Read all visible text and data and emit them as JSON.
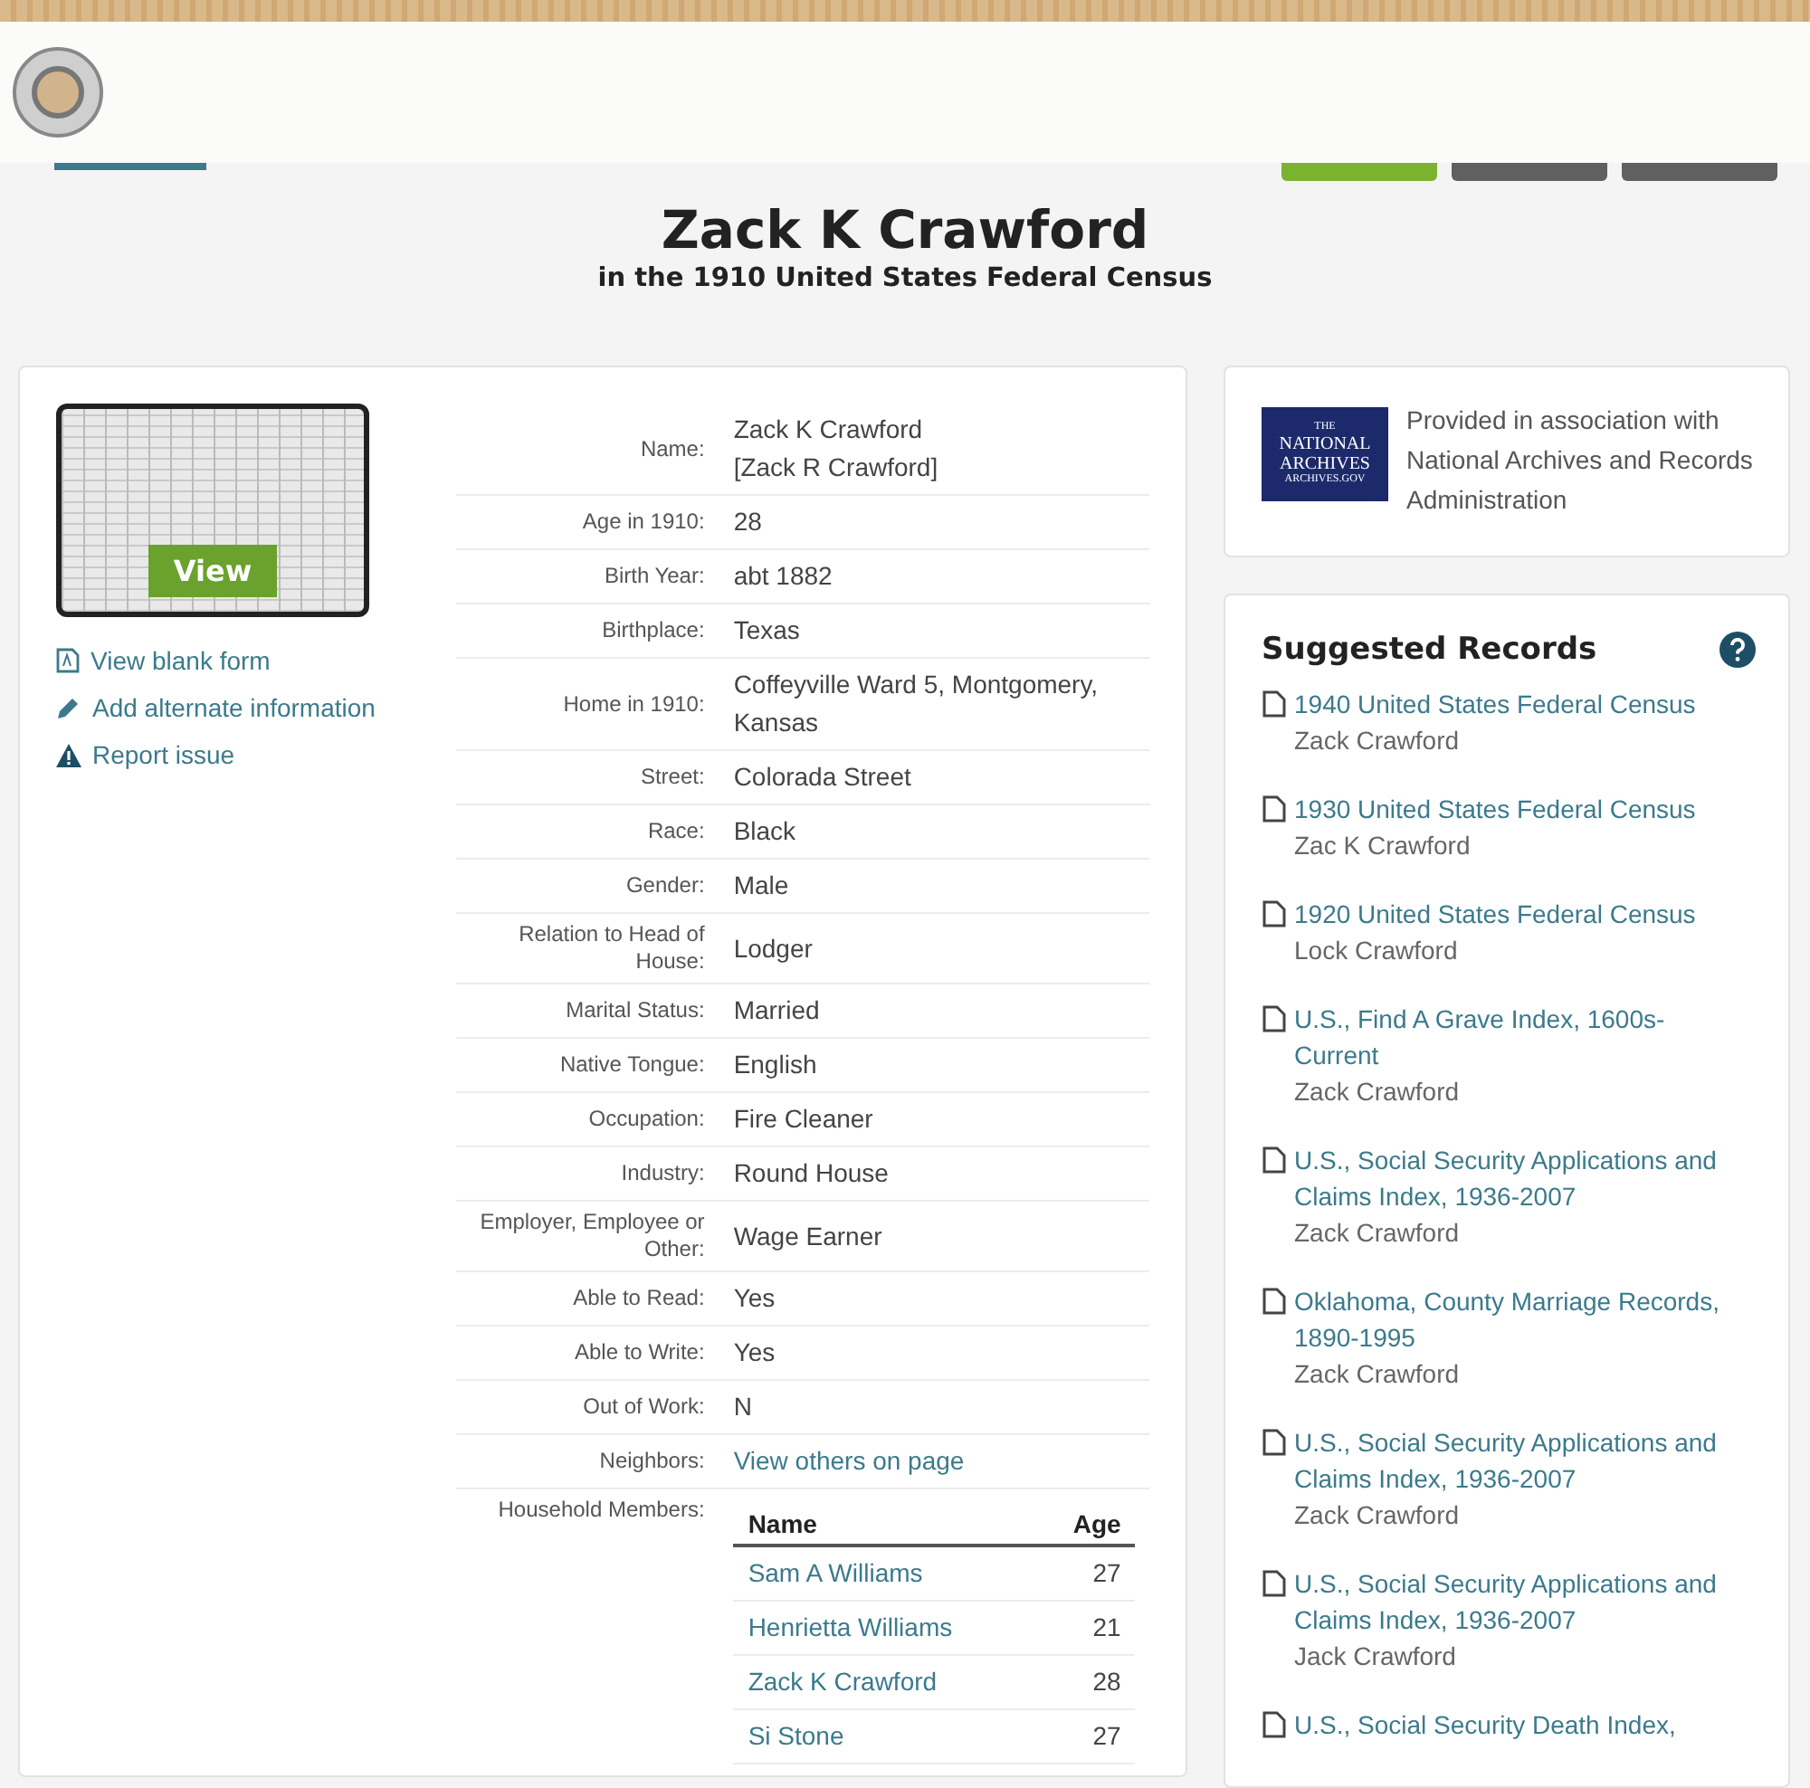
{
  "top_buttons": [
    {
      "kind": "primary"
    },
    {
      "kind": "secondary"
    },
    {
      "kind": "secondary"
    }
  ],
  "title": "Zack K Crawford",
  "subtitle": "in the 1910 United States Federal Census",
  "image": {
    "button": "View"
  },
  "side_links": [
    {
      "kind": "form",
      "label": "View blank form"
    },
    {
      "kind": "edit",
      "label": "Add alternate information"
    },
    {
      "kind": "warning",
      "label": "Report issue"
    }
  ],
  "fields": [
    {
      "label": "Name:",
      "values": [
        "Zack K Crawford",
        "[Zack R Crawford]"
      ],
      "kind": "text"
    },
    {
      "label": "Age in 1910:",
      "values": [
        "28"
      ],
      "kind": "text"
    },
    {
      "label": "Birth Year:",
      "values": [
        "abt 1882"
      ],
      "kind": "text"
    },
    {
      "label": "Birthplace:",
      "values": [
        "Texas"
      ],
      "kind": "text"
    },
    {
      "label": "Home in 1910:",
      "values": [
        "Coffeyville Ward 5, Montgomery, Kansas"
      ],
      "kind": "text"
    },
    {
      "label": "Street:",
      "values": [
        "Colorada Street"
      ],
      "kind": "text"
    },
    {
      "label": "Race:",
      "values": [
        "Black"
      ],
      "kind": "text"
    },
    {
      "label": "Gender:",
      "values": [
        "Male"
      ],
      "kind": "text"
    },
    {
      "label": "Relation to Head of House:",
      "values": [
        "Lodger"
      ],
      "kind": "text"
    },
    {
      "label": "Marital Status:",
      "values": [
        "Married"
      ],
      "kind": "text"
    },
    {
      "label": "Native Tongue:",
      "values": [
        "English"
      ],
      "kind": "text"
    },
    {
      "label": "Occupation:",
      "values": [
        "Fire Cleaner"
      ],
      "kind": "text"
    },
    {
      "label": "Industry:",
      "values": [
        "Round House"
      ],
      "kind": "text"
    },
    {
      "label": "Employer, Employee or Other:",
      "values": [
        "Wage Earner"
      ],
      "kind": "text"
    },
    {
      "label": "Able to Read:",
      "values": [
        "Yes"
      ],
      "kind": "text"
    },
    {
      "label": "Able to Write:",
      "values": [
        "Yes"
      ],
      "kind": "text"
    },
    {
      "label": "Out of Work:",
      "values": [
        "N"
      ],
      "kind": "text"
    },
    {
      "label": "Neighbors:",
      "values": [
        "View others on page"
      ],
      "kind": "link"
    }
  ],
  "household": {
    "label": "Household Members:",
    "columns": [
      "Name",
      "Age"
    ],
    "rows": [
      {
        "name": "Sam A Williams",
        "age": "27"
      },
      {
        "name": "Henrietta Williams",
        "age": "21"
      },
      {
        "name": "Zack K Crawford",
        "age": "28"
      },
      {
        "name": "Si Stone",
        "age": "27"
      }
    ]
  },
  "provider": {
    "logo_lines": [
      "THE",
      "NATIONAL",
      "ARCHIVES",
      "ARCHIVES.GOV"
    ],
    "text": "Provided in association with National Archives and Records Administration"
  },
  "suggested": {
    "title": "Suggested Records",
    "items": [
      {
        "title": "1940 United States Federal Census",
        "person": "Zack Crawford"
      },
      {
        "title": "1930 United States Federal Census",
        "person": "Zac K Crawford"
      },
      {
        "title": "1920 United States Federal Census",
        "person": "Lock Crawford"
      },
      {
        "title": "U.S., Find A Grave Index, 1600s-Current",
        "person": "Zack Crawford"
      },
      {
        "title": "U.S., Social Security Applications and Claims Index, 1936-2007",
        "person": "Zack Crawford"
      },
      {
        "title": "Oklahoma, County Marriage Records, 1890-1995",
        "person": "Zack Crawford"
      },
      {
        "title": "U.S., Social Security Applications and Claims Index, 1936-2007",
        "person": "Zack Crawford"
      },
      {
        "title": "U.S., Social Security Applications and Claims Index, 1936-2007",
        "person": "Jack Crawford"
      },
      {
        "title": "U.S., Social Security Death Index,"
      }
    ]
  }
}
